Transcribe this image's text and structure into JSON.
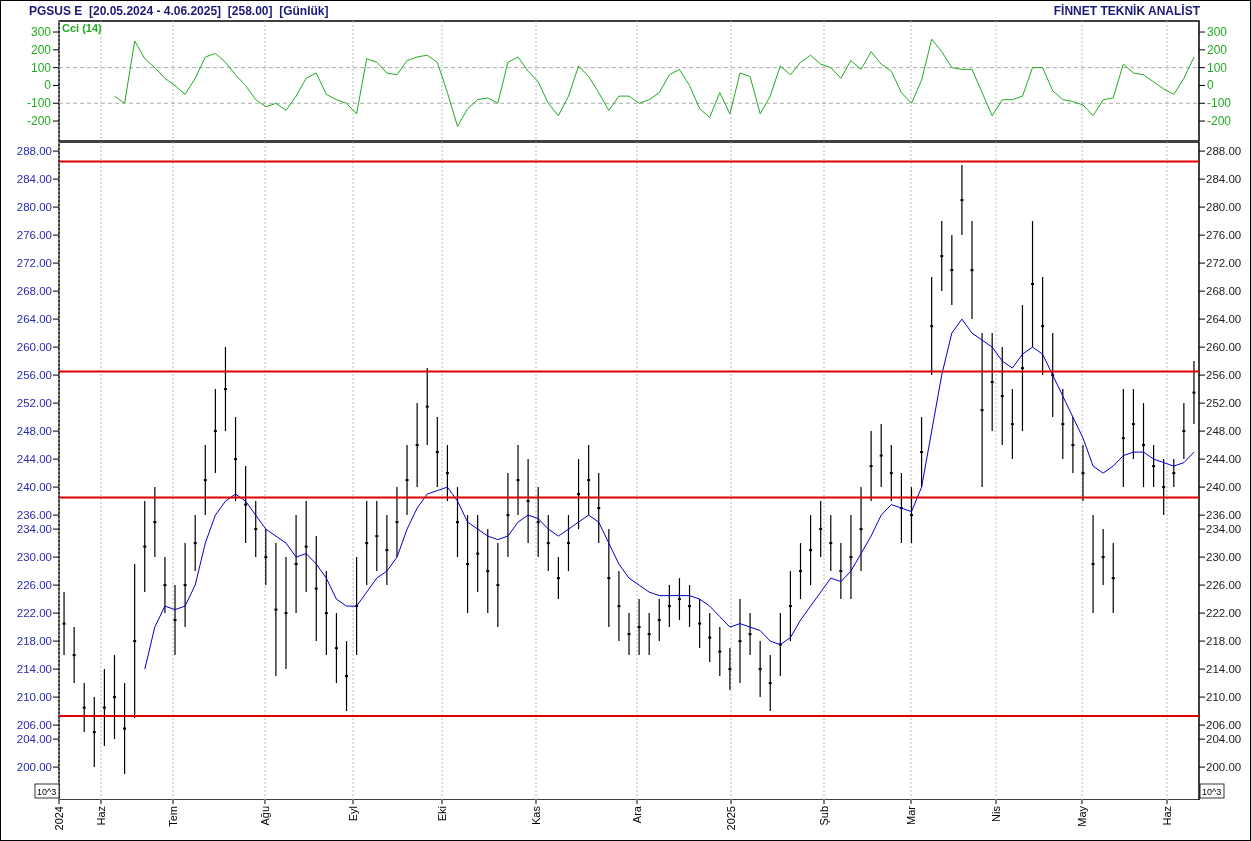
{
  "header": {
    "title": "PGSUS E  [20.05.2024 - 4.06.2025]  [258.00]  [Günlük]",
    "brand": "FİNNET TEKNİK ANALİST"
  },
  "indicator_panel": {
    "chart_data": {
      "type": "line",
      "grid": true,
      "ylim": [
        -312,
        362
      ],
      "yticks": [
        {
          "value": 300,
          "label": "300"
        },
        {
          "value": 200,
          "label": "200"
        },
        {
          "value": 100,
          "label": "100"
        },
        {
          "value": 0,
          "label": "0"
        },
        {
          "value": -100,
          "label": "-100"
        },
        {
          "value": -200,
          "label": "-200"
        }
      ],
      "series": [
        {
          "name": "Cci (14)",
          "color": "#22aa22",
          "values": [
            null,
            null,
            null,
            null,
            null,
            -60,
            -100,
            250,
            150,
            100,
            40,
            0,
            -50,
            40,
            160,
            180,
            130,
            60,
            0,
            -80,
            -120,
            -100,
            -140,
            -60,
            40,
            70,
            -50,
            -80,
            -100,
            -160,
            150,
            130,
            70,
            60,
            140,
            160,
            170,
            130,
            -40,
            -230,
            -130,
            -80,
            -70,
            -100,
            130,
            160,
            80,
            20,
            -100,
            -170,
            -60,
            110,
            50,
            -40,
            -140,
            -60,
            -60,
            -100,
            -80,
            -40,
            60,
            90,
            0,
            -130,
            -180,
            -40,
            -160,
            70,
            50,
            -160,
            -60,
            110,
            60,
            130,
            170,
            120,
            100,
            40,
            140,
            90,
            190,
            120,
            80,
            -40,
            -100,
            30,
            260,
            190,
            100,
            90,
            90,
            -40,
            -170,
            -80,
            -80,
            -60,
            100,
            100,
            -30,
            -80,
            -90,
            -110,
            -170,
            -80,
            -70,
            120,
            70,
            60,
            20,
            -20,
            -50,
            40,
            160
          ]
        }
      ],
      "ref_lines": [
        {
          "value": 100,
          "axis": "y"
        },
        {
          "value": -100,
          "axis": "y"
        }
      ]
    }
  },
  "price_panel": {
    "chart_data": {
      "type": "line",
      "grid": true,
      "ylim": [
        195.3,
        289.3
      ],
      "yticks": [
        {
          "value": 288,
          "label": "288.00"
        },
        {
          "value": 284,
          "label": "284.00"
        },
        {
          "value": 280,
          "label": "280.00"
        },
        {
          "value": 276,
          "label": "276.00"
        },
        {
          "value": 272,
          "label": "272.00"
        },
        {
          "value": 268,
          "label": "268.00"
        },
        {
          "value": 264,
          "label": "264.00"
        },
        {
          "value": 260,
          "label": "260.00"
        },
        {
          "value": 256,
          "label": "256.00"
        },
        {
          "value": 252,
          "label": "252.00"
        },
        {
          "value": 248,
          "label": "248.00"
        },
        {
          "value": 244,
          "label": "244.00"
        },
        {
          "value": 240,
          "label": "240.00"
        },
        {
          "value": 236,
          "label": "236.00"
        },
        {
          "value": 234,
          "label": "234.00"
        },
        {
          "value": 230,
          "label": "230.00"
        },
        {
          "value": 226,
          "label": "226.00"
        },
        {
          "value": 222,
          "label": "222.00"
        },
        {
          "value": 218,
          "label": "218.00"
        },
        {
          "value": 214,
          "label": "214.00"
        },
        {
          "value": 210,
          "label": "210.00"
        },
        {
          "value": 206,
          "label": "206.00"
        },
        {
          "value": 204,
          "label": "204.00"
        },
        {
          "value": 200,
          "label": "200.00"
        }
      ],
      "series": [
        {
          "type": "scatter",
          "color": "#000000",
          "values": [
            220.5,
            216,
            208.5,
            205,
            208.5,
            210,
            205.5,
            218,
            231.5,
            235,
            226,
            221,
            226,
            232,
            241,
            248,
            254,
            244,
            237.5,
            234,
            230,
            222.5,
            222,
            229,
            231.5,
            225.5,
            222,
            217,
            213,
            223,
            232,
            233,
            231,
            235,
            241,
            246,
            251.5,
            245,
            242,
            235,
            229,
            230.5,
            228,
            226,
            236,
            241,
            238,
            235,
            232,
            227,
            232,
            239,
            241,
            237,
            227,
            223,
            219,
            220,
            219,
            221,
            223,
            224,
            223,
            220.5,
            218.5,
            216.5,
            214,
            218,
            219,
            214,
            212,
            217.5,
            223,
            228,
            231,
            234,
            232,
            228,
            230,
            234,
            243,
            244.5,
            242,
            237,
            236,
            245,
            263,
            273,
            271,
            281,
            271,
            251,
            255,
            253,
            249,
            257,
            269,
            263,
            256,
            249,
            246,
            242,
            229,
            230,
            227,
            247,
            249,
            246,
            243,
            240,
            242,
            248,
            253.5
          ],
          "errors": [
            4.5,
            4,
            3.5,
            5,
            5.5,
            6,
            6.5,
            11,
            6.5,
            5,
            4,
            5,
            6,
            4,
            5,
            6,
            6,
            6,
            5.5,
            4,
            4,
            9.5,
            8,
            7,
            6.5,
            7.5,
            6,
            5,
            5,
            7,
            6,
            5,
            5,
            5,
            5,
            6,
            5.5,
            5,
            4,
            5,
            7,
            5.5,
            6,
            6,
            6,
            5,
            6,
            5,
            4,
            3,
            4,
            5,
            5,
            5,
            7,
            5,
            3,
            4,
            3,
            3,
            3,
            3,
            3,
            3.5,
            3.5,
            3.5,
            3,
            6,
            3,
            4,
            4,
            4.5,
            5,
            4,
            5,
            4,
            4,
            4,
            6,
            6,
            5,
            4.5,
            4,
            5,
            4,
            5,
            7,
            5,
            5,
            5,
            7,
            11,
            7,
            7,
            5,
            9,
            9,
            7,
            6,
            5,
            4,
            4,
            7,
            4,
            5,
            7,
            5,
            6,
            3,
            4,
            2,
            4,
            4.5
          ]
        },
        {
          "color": "#0000cc",
          "values": [
            null,
            null,
            null,
            null,
            null,
            null,
            null,
            null,
            214,
            220,
            223,
            222.5,
            223,
            226,
            232,
            236,
            238,
            239,
            238,
            236,
            234,
            233,
            232,
            230,
            230.5,
            229,
            227,
            224,
            223,
            223,
            225,
            227,
            228,
            230,
            234,
            237,
            239,
            239.5,
            240,
            238,
            235,
            234,
            233,
            232.5,
            233,
            235,
            236,
            235.5,
            234,
            233,
            234,
            235,
            236,
            235,
            232,
            229,
            227,
            226,
            225,
            224.5,
            224.5,
            224.5,
            224.5,
            224,
            223,
            221.5,
            220,
            220.5,
            220,
            219.5,
            218,
            217.5,
            218.5,
            221,
            223,
            225,
            227,
            226.5,
            228,
            230.5,
            233,
            236,
            237.5,
            237,
            236.5,
            240,
            248,
            256,
            262,
            264,
            262,
            261,
            260,
            258,
            257,
            259,
            260,
            259,
            256,
            253,
            250,
            247,
            243,
            242,
            243,
            244.5,
            245,
            245,
            244,
            243.5,
            243,
            243.5,
            245
          ]
        }
      ],
      "ref_lines": [
        {
          "value": 286.5,
          "axis": "y"
        },
        {
          "value": 256.5,
          "axis": "y"
        },
        {
          "value": 238.5,
          "axis": "y"
        },
        {
          "value": 207.3,
          "axis": "y"
        }
      ]
    },
    "units": [
      "10^3",
      "10^3"
    ]
  },
  "time_axis": {
    "labels": [
      "2024",
      "Haz",
      "Tem",
      "Ağu",
      "Eyl",
      "Eki",
      "Kas",
      "Ara",
      "2025",
      "Şub",
      "Mar",
      "Nis",
      "May",
      "Haz"
    ]
  }
}
